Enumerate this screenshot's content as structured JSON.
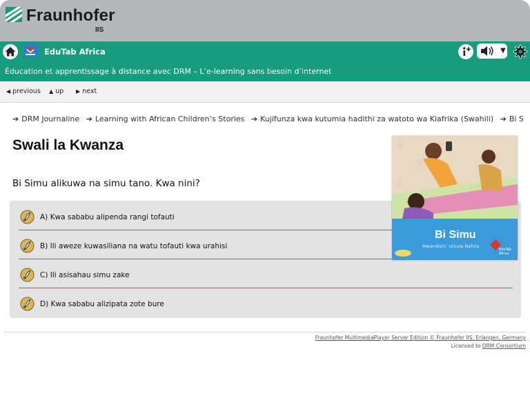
{
  "brand": {
    "name": "Fraunhofer",
    "sub": "IIS"
  },
  "app": {
    "title": "EduTab Africa",
    "subtitle": "Éducation et apprentissage à distance avec DRM – L’e-learning sans besoin d’internet"
  },
  "nav": {
    "previous": "previous",
    "up": "up",
    "next": "next"
  },
  "breadcrumb": [
    "DRM Journaline",
    "Learning with African Children’s Stories",
    "Kujifunza kwa kutumia hadithi za watoto wa Kiafrika (Swahili)",
    "Bi Simu (Swahili)"
  ],
  "question": {
    "title": "Swali la Kwanza",
    "text": "Bi Simu alikuwa na simu tano. Kwa nini?"
  },
  "answers": [
    "A) Kwa sababu alipenda rangi tofauti",
    "B) Ili aweze kuwasiliana na watu tofauti kwa urahisi",
    "C) Ili asisahau simu zake",
    "D) Kwa sababu alizipata zote bure"
  ],
  "cover": {
    "title": "Bi Simu",
    "author": "Mwandishi: Ursula Nafula",
    "logo_line1": "EduTab",
    "logo_line2": "Africa"
  },
  "footer": {
    "line1": "Fraunhofer MultimediaPlayer Server Edition © Fraunhofer IIS, Erlangen, Germany",
    "line2_prefix": "Licensed to",
    "line2_link": "DRM Consortium"
  },
  "colors": {
    "accent": "#179c7d",
    "header_gray": "#b5b8ba",
    "answer_bg": "#e3e3e3",
    "cover_blue": "#3b9ad9"
  }
}
